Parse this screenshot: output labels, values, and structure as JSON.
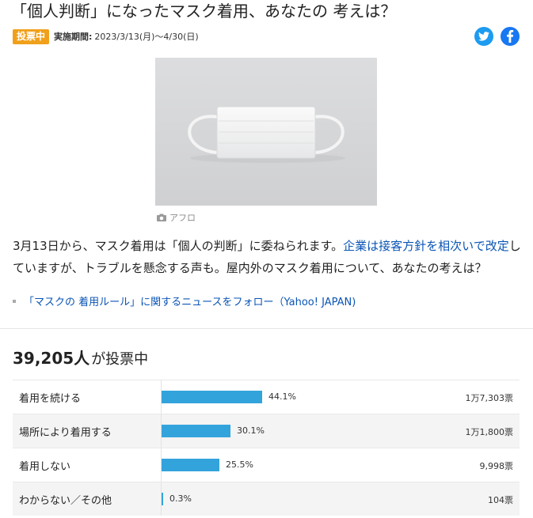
{
  "title": "「個人判断」になったマスク着用、あなたの 考えは？",
  "badge": "投票中",
  "period_label": "実施期間:",
  "period_value": "2023/3/13(月)〜4/30(日)",
  "photo_credit": "アフロ",
  "description": {
    "part1": "3月13日から、マスク着用は「個人の判断」に委ねられます。",
    "link": "企業は接客方針を相次いで改定",
    "part2": "していますが、トラブルを懸念する声も。屋内外のマスク着用について、あなたの考えは？"
  },
  "follow_link": "「マスクの 着用ルール」に関するニュースをフォロー（Yahoo! JAPAN)",
  "voters": {
    "count": "39,205人",
    "suffix": "が投票中"
  },
  "results": [
    {
      "label": "着用を続ける",
      "percent": 44.1,
      "percent_text": "44.1%",
      "votes": "1万7,303票"
    },
    {
      "label": "場所により着用する",
      "percent": 30.1,
      "percent_text": "30.1%",
      "votes": "1万1,800票"
    },
    {
      "label": "着用しない",
      "percent": 25.5,
      "percent_text": "25.5%",
      "votes": "9,998票"
    },
    {
      "label": "わからない／その他",
      "percent": 0.3,
      "percent_text": "0.3%",
      "votes": "104票"
    }
  ],
  "colors": {
    "badge": "#f0a01a",
    "bar": "#33a3dc",
    "link": "#0b55b5",
    "twitter": "#1d9bf0",
    "facebook": "#1877f2"
  },
  "icons": {
    "share_twitter": "twitter-icon",
    "share_facebook": "facebook-icon",
    "credit": "camera-icon"
  }
}
